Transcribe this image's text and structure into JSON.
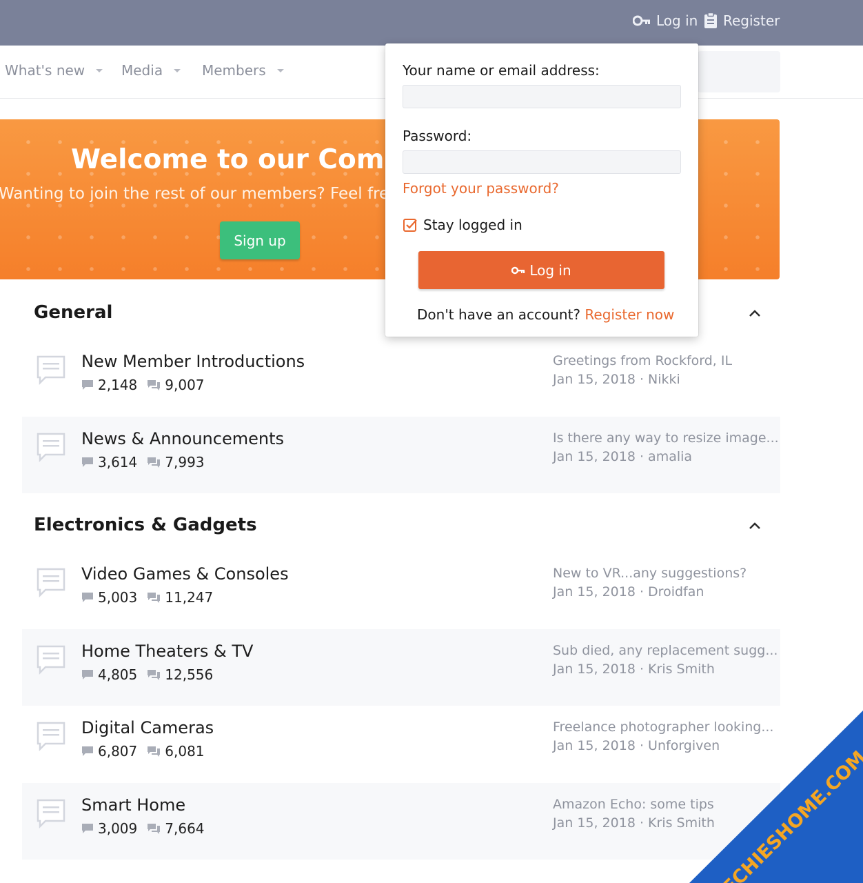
{
  "header": {
    "login_label": "Log in",
    "register_label": "Register"
  },
  "nav": {
    "items": [
      {
        "label": "What's new"
      },
      {
        "label": "Media"
      },
      {
        "label": "Members"
      }
    ]
  },
  "banner": {
    "title": "Welcome to our Commu",
    "subtitle": "Wanting to join the rest of our members? Feel free",
    "signup_label": "Sign up"
  },
  "sections": [
    {
      "title": "General",
      "forums": [
        {
          "name": "New Member Introductions",
          "threads": "2,148",
          "messages": "9,007",
          "latest_title": "Greetings from Rockford, IL",
          "latest_meta": "Jan 15, 2018 · Nikki"
        },
        {
          "name": "News & Announcements",
          "threads": "3,614",
          "messages": "7,993",
          "latest_title": "Is there any way to resize image...",
          "latest_meta": "Jan 15, 2018 · amalia"
        }
      ]
    },
    {
      "title": "Electronics & Gadgets",
      "forums": [
        {
          "name": "Video Games & Consoles",
          "threads": "5,003",
          "messages": "11,247",
          "latest_title": "New to VR...any suggestions?",
          "latest_meta": "Jan 15, 2018 · Droidfan"
        },
        {
          "name": "Home Theaters & TV",
          "threads": "4,805",
          "messages": "12,556",
          "latest_title": "Sub died, any replacement sugg...",
          "latest_meta": "Jan 15, 2018 · Kris Smith"
        },
        {
          "name": "Digital Cameras",
          "threads": "6,807",
          "messages": "6,081",
          "latest_title": "Freelance photographer looking...",
          "latest_meta": "Jan 15, 2018 · Unforgiven"
        },
        {
          "name": "Smart Home",
          "threads": "3,009",
          "messages": "7,664",
          "latest_title": "Amazon Echo: some tips",
          "latest_meta": "Jan 15, 2018 · Kris Smith"
        }
      ]
    }
  ],
  "login_popup": {
    "name_label": "Your name or email address:",
    "name_value": "",
    "password_label": "Password:",
    "password_value": "",
    "forgot_label": "Forgot your password?",
    "stay_logged_in_label": "Stay logged in",
    "stay_logged_in_checked": true,
    "login_button_label": "Log in",
    "no_account_text": "Don't have an account? ",
    "register_now_label": "Register now"
  },
  "watermark": {
    "text": "TECHIESHOME.COM"
  },
  "colors": {
    "topbar": "#7a8199",
    "accent": "#e86532",
    "banner": "#f7892f",
    "signup": "#3cbf7c",
    "watermark_bg": "#1e5fc4",
    "watermark_text": "#f5a623"
  }
}
